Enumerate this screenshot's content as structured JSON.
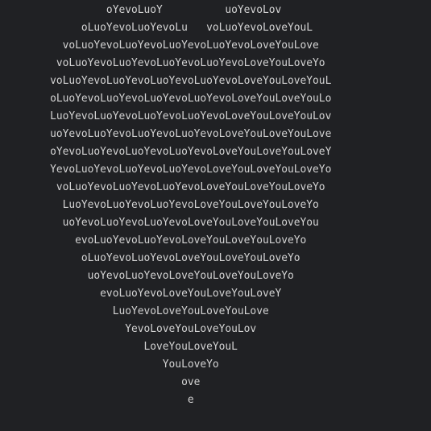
{
  "terminal": {
    "text_color": "#d4d4d4",
    "background": "#202124",
    "lines": [
      "                 oYevoLuoY          uoYevoLov",
      "             oLuoYevoLuoYevoLu   voLuoYevoLoveYouL",
      "          voLuoYevoLuoYevoLuoYevoLuoYevoLoveYouLove",
      "         voLuoYevoLuoYevoLuoYevoLuoYevoLoveYouLoveYo",
      "        voLuoYevoLuoYevoLuoYevoLuoYevoLoveYouLoveYouL",
      "        oLuoYevoLuoYevoLuoYevoLuoYevoLoveYouLoveYouLo",
      "        LuoYevoLuoYevoLuoYevoLuoYevoLoveYouLoveYouLov",
      "        uoYevoLuoYevoLuoYevoLuoYevoLoveYouLoveYouLove",
      "        oYevoLuoYevoLuoYevoLuoYevoLoveYouLoveYouLoveY",
      "        YevoLuoYevoLuoYevoLuoYevoLoveYouLoveYouLoveYo",
      "         voLuoYevoLuoYevoLuoYevoLoveYouLoveYouLoveYo",
      "          LuoYevoLuoYevoLuoYevoLoveYouLoveYouLoveYo",
      "          uoYevoLuoYevoLuoYevoLoveYouLoveYouLoveYou",
      "            evoLuoYevoLuoYevoLoveYouLoveYouLoveYo",
      "             oLuoYevoLuoYevoLoveYouLoveYouLoveYo",
      "              uoYevoLuoYevoLoveYouLoveYouLoveYo",
      "                evoLuoYevoLoveYouLoveYouLoveY",
      "                  LuoYevoLoveYouLoveYouLove",
      "                    YevoLoveYouLoveYouLov",
      "                       LoveYouLoveYouL",
      "                          YouLoveYo",
      "                             ove",
      "                              e"
    ]
  }
}
